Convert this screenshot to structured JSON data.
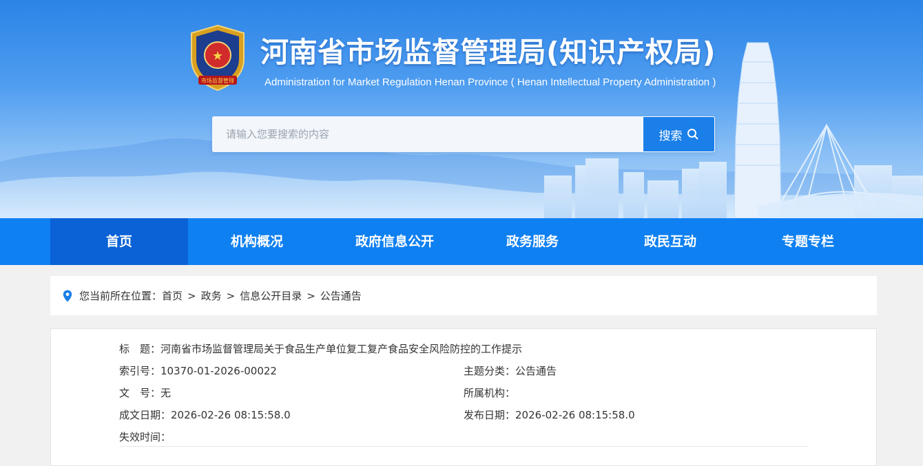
{
  "header": {
    "title": "河南省市场监督管理局(知识产权局)",
    "subtitle": "Administration for  Market Regulation Henan Province ( Henan Intellectual Property  Administration )",
    "emblem_icon": "market-regulation-emblem",
    "emblem_text": "市场监督管理"
  },
  "search": {
    "placeholder": "请输入您要搜索的内容",
    "value": "",
    "button_label": "搜索",
    "button_icon": "search-icon"
  },
  "nav": {
    "items": [
      {
        "label": "首页",
        "active": true
      },
      {
        "label": "机构概况",
        "active": false
      },
      {
        "label": "政府信息公开",
        "active": false
      },
      {
        "label": "政务服务",
        "active": false
      },
      {
        "label": "政民互动",
        "active": false
      },
      {
        "label": "专题专栏",
        "active": false
      }
    ]
  },
  "breadcrumb": {
    "icon": "location-pin-icon",
    "prefix": "您当前所在位置：",
    "items": [
      "首页",
      "政务",
      "信息公开目录",
      "公告通告"
    ],
    "separator": ">"
  },
  "meta": {
    "title_label": "标　题：",
    "title_value": "河南省市场监督管理局关于食品生产单位复工复产食品安全风险防控的工作提示",
    "index_label": "索引号：",
    "index_value": "10370-01-2026-00022",
    "category_label": "主题分类：",
    "category_value": "公告通告",
    "docno_label": "文　号：",
    "docno_value": "无",
    "org_label": "所属机构：",
    "org_value": "",
    "created_label": "成文日期：",
    "created_value": "2026-02-26 08:15:58.0",
    "published_label": "发布日期：",
    "published_value": "2026-02-26 08:15:58.0",
    "expire_label": "失效时间：",
    "expire_value": ""
  },
  "colors": {
    "nav_bg": "#0f80f1",
    "nav_active": "#0a62d6",
    "search_button": "#1a7fe8",
    "page_bg": "#f1f1f1",
    "pin": "#1a7fe8"
  }
}
